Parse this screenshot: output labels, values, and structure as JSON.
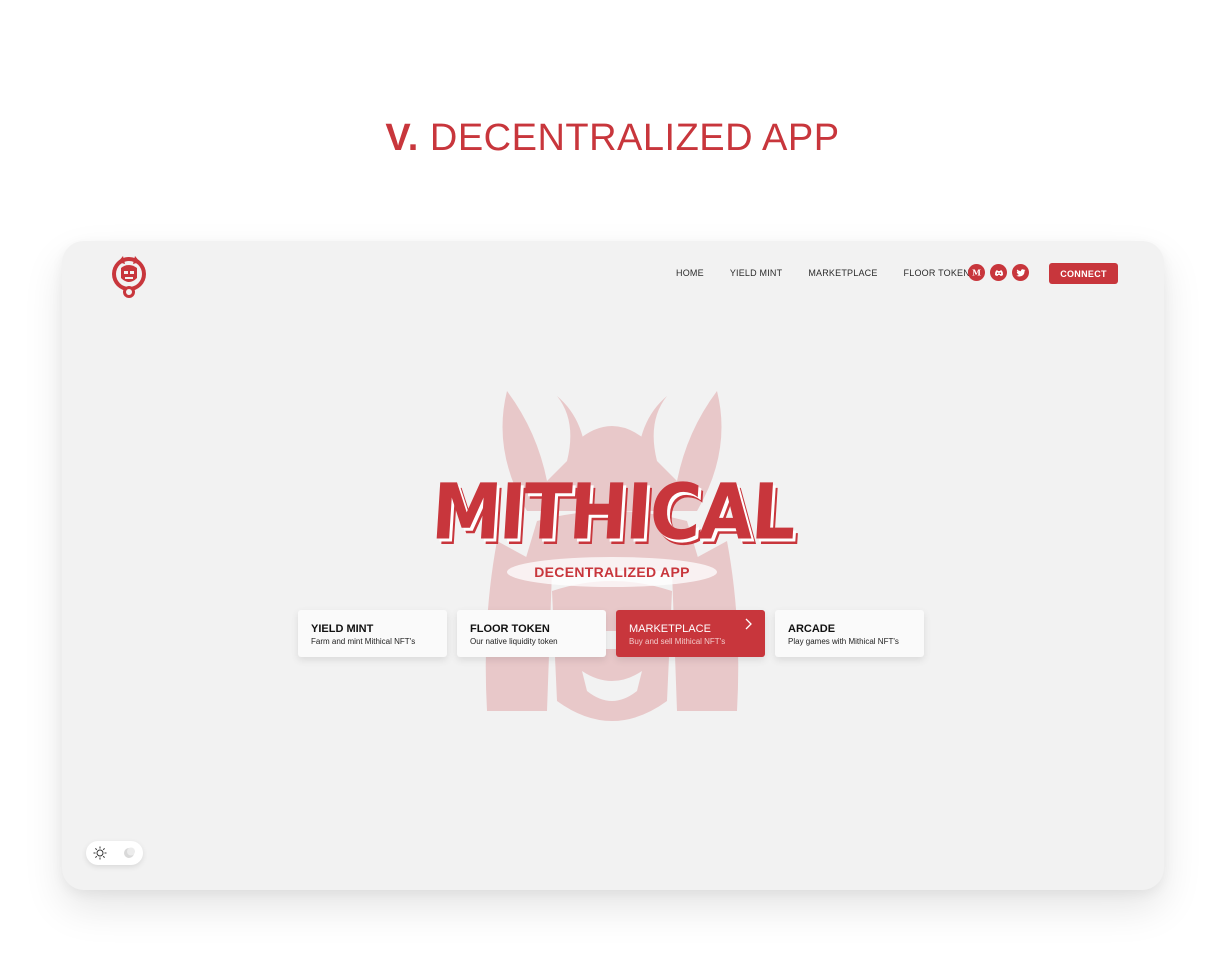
{
  "heading": {
    "number": "V.",
    "text": "DECENTRALIZED APP"
  },
  "nav": {
    "items": [
      {
        "label": "HOME"
      },
      {
        "label": "YIELD MINT"
      },
      {
        "label": "MARKETPLACE"
      },
      {
        "label": "FLOOR TOKEN"
      }
    ],
    "social": [
      {
        "icon": "medium-icon",
        "glyph": "M"
      },
      {
        "icon": "discord-icon"
      },
      {
        "icon": "twitter-icon"
      }
    ],
    "connect_label": "CONNECT"
  },
  "hero": {
    "brand": "MITHICAL",
    "subtitle": "DECENTRALIZED APP"
  },
  "cards": [
    {
      "title": "YIELD MINT",
      "desc": "Farm and mint Mithical NFT's",
      "active": false
    },
    {
      "title": "FLOOR TOKEN",
      "desc": "Our native liquidity token",
      "active": false
    },
    {
      "title": "MARKETPLACE",
      "desc": "Buy and sell Mithical NFT's",
      "active": true
    },
    {
      "title": "ARCADE",
      "desc": "Play games with Mithical NFT's",
      "active": false
    }
  ],
  "theme_toggle": {
    "options": [
      "sun-icon",
      "moon-icon"
    ],
    "selected": "light"
  },
  "colors": {
    "accent": "#c8363c",
    "frame_bg": "#f2f2f2",
    "page_bg": "#ffffff"
  }
}
